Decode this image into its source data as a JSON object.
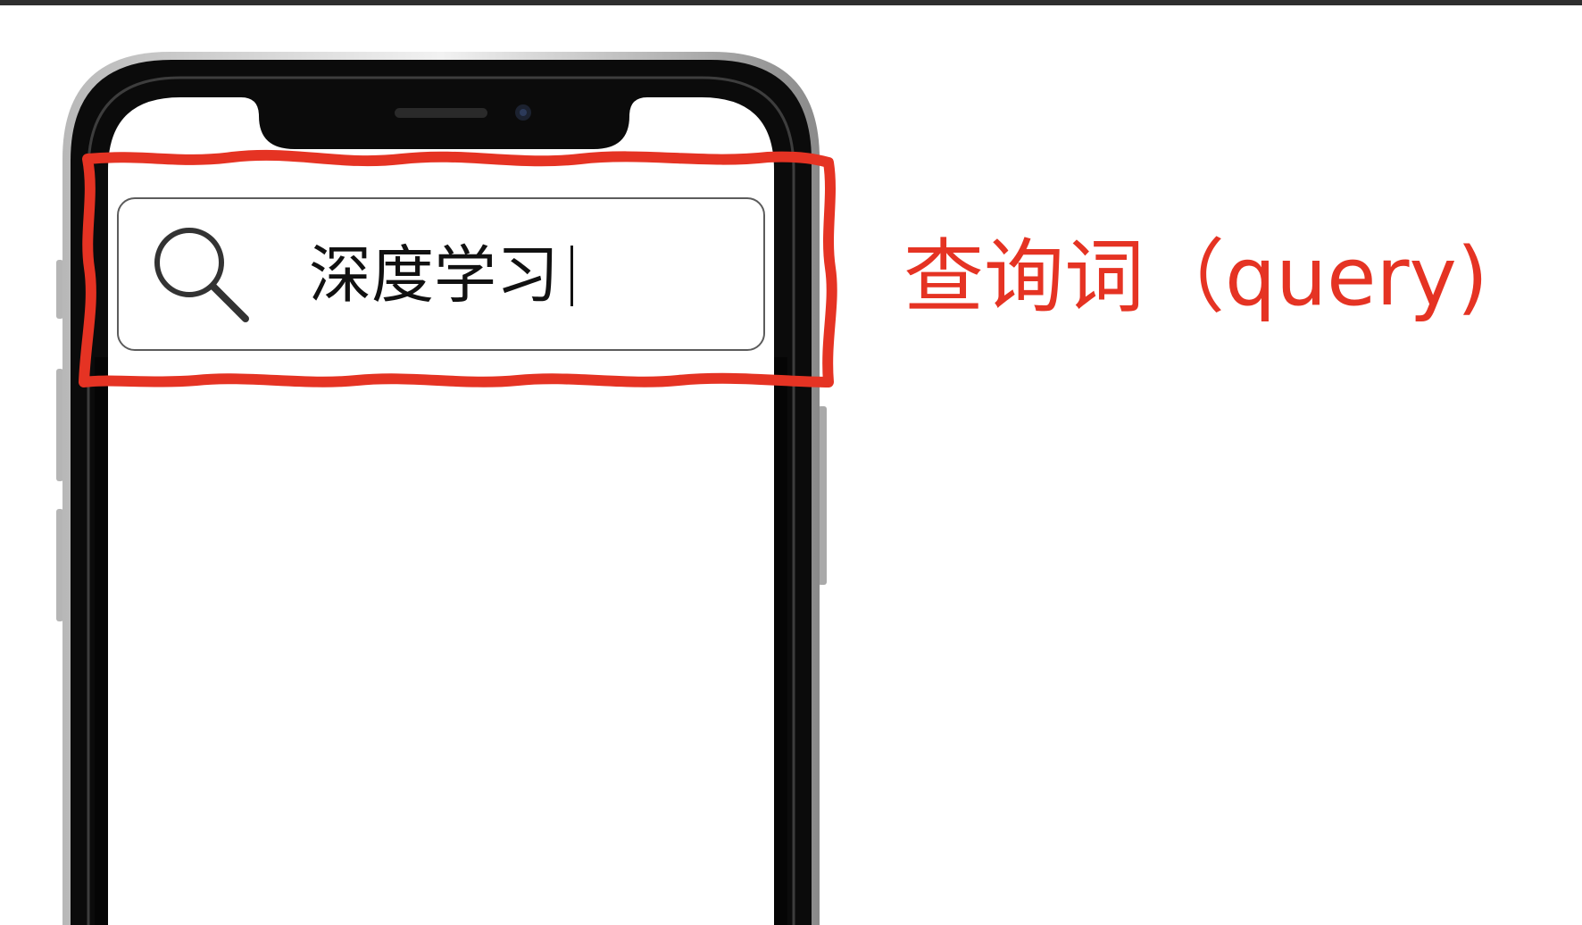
{
  "search": {
    "query": "深度学习",
    "icon": "search-icon"
  },
  "annotation": {
    "label": "查询词（query)",
    "color": "#e53323"
  },
  "colors": {
    "phone_frame": "#111111",
    "screen": "#ffffff",
    "search_border": "#5c5c5c"
  }
}
